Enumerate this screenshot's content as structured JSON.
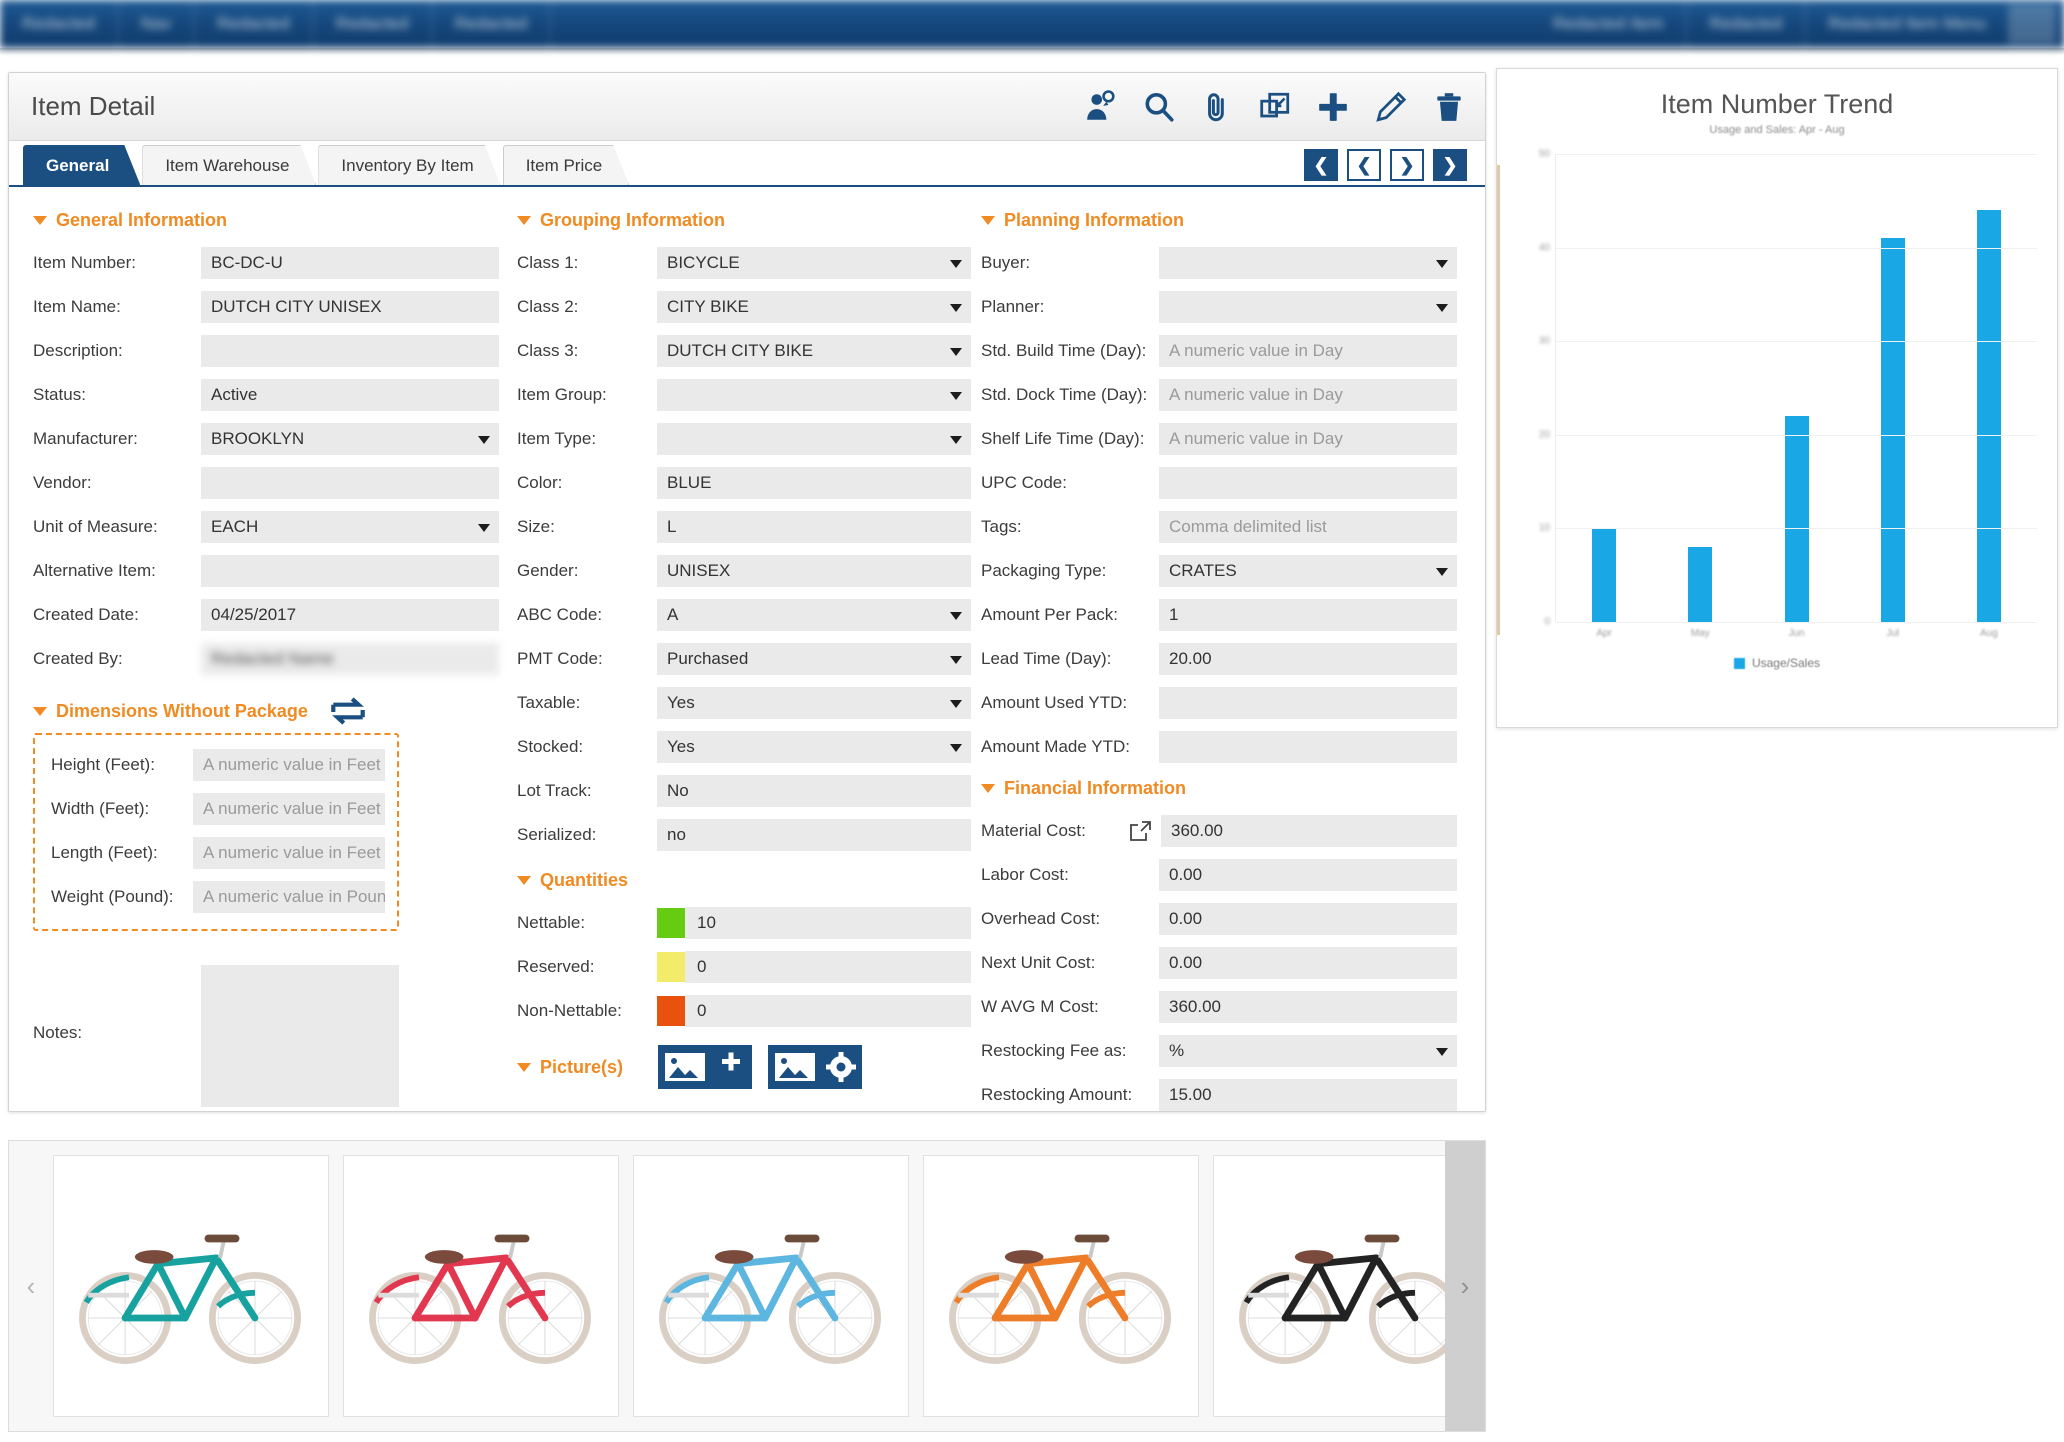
{
  "topbar": {
    "left_items": [
      "Redacted",
      "Nav",
      "Redacted",
      "Redacted",
      "Redacted"
    ],
    "right_items": [
      "Redacted Item",
      "Redacted",
      "Redacted Item Menu"
    ],
    "note": "blurred"
  },
  "panel": {
    "title": "Item Detail",
    "toolbar": [
      {
        "name": "user-lookup-icon",
        "label": "User Lookup"
      },
      {
        "name": "search-icon",
        "label": "Search"
      },
      {
        "name": "attachment-icon",
        "label": "Attachment"
      },
      {
        "name": "copy-icon",
        "label": "Copy"
      },
      {
        "name": "add-icon",
        "label": "Add"
      },
      {
        "name": "edit-icon",
        "label": "Edit"
      },
      {
        "name": "delete-icon",
        "label": "Delete"
      }
    ],
    "tabs": [
      {
        "label": "General",
        "active": true
      },
      {
        "label": "Item Warehouse",
        "active": false
      },
      {
        "label": "Inventory By Item",
        "active": false
      },
      {
        "label": "Item Price",
        "active": false
      }
    ],
    "record_nav": [
      {
        "name": "first-record-button",
        "glyph": "❮",
        "style": "filled"
      },
      {
        "name": "previous-record-button",
        "glyph": "❮",
        "style": "hollow"
      },
      {
        "name": "next-record-button",
        "glyph": "❯",
        "style": "hollow"
      },
      {
        "name": "last-record-button",
        "glyph": "❯",
        "style": "filled"
      }
    ]
  },
  "general_information": {
    "heading": "General Information",
    "fields": [
      {
        "label": "Item Number:",
        "value": "BC-DC-U",
        "placeholder": "",
        "type": "text"
      },
      {
        "label": "Item Name:",
        "value": "DUTCH CITY UNISEX",
        "placeholder": "",
        "type": "text"
      },
      {
        "label": "Description:",
        "value": "",
        "placeholder": "",
        "type": "text"
      },
      {
        "label": "Status:",
        "value": "Active",
        "placeholder": "",
        "type": "text"
      },
      {
        "label": "Manufacturer:",
        "value": "BROOKLYN",
        "placeholder": "",
        "type": "select"
      },
      {
        "label": "Vendor:",
        "value": "",
        "placeholder": "",
        "type": "text"
      },
      {
        "label": "Unit of Measure:",
        "value": "EACH",
        "placeholder": "",
        "type": "select"
      },
      {
        "label": "Alternative Item:",
        "value": "",
        "placeholder": "",
        "type": "text"
      },
      {
        "label": "Created Date:",
        "value": "04/25/2017",
        "placeholder": "",
        "type": "text"
      },
      {
        "label": "Created By:",
        "value": "Redacted Name",
        "placeholder": "",
        "type": "text",
        "blurred": true
      }
    ]
  },
  "dimensions": {
    "heading": "Dimensions Without Package",
    "swap_icon": "swap-units-icon",
    "fields": [
      {
        "label": "Height (Feet):",
        "value": "",
        "placeholder": "A numeric value in Feet",
        "type": "text"
      },
      {
        "label": "Width (Feet):",
        "value": "",
        "placeholder": "A numeric value in Feet",
        "type": "text"
      },
      {
        "label": "Length (Feet):",
        "value": "",
        "placeholder": "A numeric value in Feet",
        "type": "text"
      },
      {
        "label": "Weight (Pound):",
        "value": "",
        "placeholder": "A numeric value in Pound",
        "type": "text"
      }
    ]
  },
  "notes": {
    "label": "Notes:",
    "value": ""
  },
  "grouping_information": {
    "heading": "Grouping Information",
    "fields": [
      {
        "label": "Class 1:",
        "value": "BICYCLE",
        "placeholder": "",
        "type": "select"
      },
      {
        "label": "Class 2:",
        "value": "CITY BIKE",
        "placeholder": "",
        "type": "select"
      },
      {
        "label": "Class 3:",
        "value": "DUTCH CITY BIKE",
        "placeholder": "",
        "type": "select"
      },
      {
        "label": "Item Group:",
        "value": "",
        "placeholder": "",
        "type": "select"
      },
      {
        "label": "Item Type:",
        "value": "",
        "placeholder": "",
        "type": "select"
      },
      {
        "label": "Color:",
        "value": "BLUE",
        "placeholder": "",
        "type": "text"
      },
      {
        "label": "Size:",
        "value": "L",
        "placeholder": "",
        "type": "text"
      },
      {
        "label": "Gender:",
        "value": "UNISEX",
        "placeholder": "",
        "type": "text"
      },
      {
        "label": "ABC Code:",
        "value": "A",
        "placeholder": "",
        "type": "select"
      },
      {
        "label": "PMT Code:",
        "value": "Purchased",
        "placeholder": "",
        "type": "select"
      },
      {
        "label": "Taxable:",
        "value": "Yes",
        "placeholder": "",
        "type": "select"
      },
      {
        "label": "Stocked:",
        "value": "Yes",
        "placeholder": "",
        "type": "select"
      },
      {
        "label": "Lot Track:",
        "value": "No",
        "placeholder": "",
        "type": "text"
      },
      {
        "label": "Serialized:",
        "value": "no",
        "placeholder": "",
        "type": "text"
      }
    ]
  },
  "quantities": {
    "heading": "Quantities",
    "rows": [
      {
        "label": "Nettable:",
        "value": "10",
        "color": "#66cc11"
      },
      {
        "label": "Reserved:",
        "value": "0",
        "color": "#f2ec6a"
      },
      {
        "label": "Non-Nettable:",
        "value": "0",
        "color": "#e8520e"
      }
    ]
  },
  "pictures": {
    "heading": "Picture(s)",
    "buttons": [
      {
        "name": "add-picture-button",
        "label": "Add Picture"
      },
      {
        "name": "picture-settings-button",
        "label": "Picture Settings"
      }
    ]
  },
  "planning_information": {
    "heading": "Planning Information",
    "fields": [
      {
        "label": "Buyer:",
        "value": "",
        "placeholder": "",
        "type": "select"
      },
      {
        "label": "Planner:",
        "value": "",
        "placeholder": "",
        "type": "select"
      },
      {
        "label": "Std. Build Time (Day):",
        "value": "",
        "placeholder": "A numeric value in Day",
        "type": "text"
      },
      {
        "label": "Std. Dock Time (Day):",
        "value": "",
        "placeholder": "A numeric value in Day",
        "type": "text"
      },
      {
        "label": "Shelf Life Time (Day):",
        "value": "",
        "placeholder": "A numeric value in Day",
        "type": "text"
      },
      {
        "label": "UPC Code:",
        "value": "",
        "placeholder": "",
        "type": "text"
      },
      {
        "label": "Tags:",
        "value": "",
        "placeholder": "Comma delimited list",
        "type": "text"
      },
      {
        "label": "Packaging Type:",
        "value": "CRATES",
        "placeholder": "",
        "type": "select"
      },
      {
        "label": "Amount Per Pack:",
        "value": "1",
        "placeholder": "",
        "type": "text"
      },
      {
        "label": "Lead Time (Day):",
        "value": "20.00",
        "placeholder": "",
        "type": "text"
      },
      {
        "label": "Amount Used YTD:",
        "value": "",
        "placeholder": "",
        "type": "text"
      },
      {
        "label": "Amount Made YTD:",
        "value": "",
        "placeholder": "",
        "type": "text"
      }
    ]
  },
  "financial_information": {
    "heading": "Financial Information",
    "fields": [
      {
        "label": "Material Cost:",
        "value": "360.00",
        "placeholder": "",
        "type": "text",
        "icon": "external-link-icon"
      },
      {
        "label": "Labor Cost:",
        "value": "0.00",
        "placeholder": "",
        "type": "text"
      },
      {
        "label": "Overhead Cost:",
        "value": "0.00",
        "placeholder": "",
        "type": "text"
      },
      {
        "label": "Next Unit Cost:",
        "value": "0.00",
        "placeholder": "",
        "type": "text"
      },
      {
        "label": "W AVG M Cost:",
        "value": "360.00",
        "placeholder": "",
        "type": "text"
      },
      {
        "label": "Restocking Fee as:",
        "value": "%",
        "placeholder": "",
        "type": "select"
      },
      {
        "label": "Restocking Amount:",
        "value": "15.00",
        "placeholder": "",
        "type": "text"
      }
    ]
  },
  "chart_data": {
    "type": "bar",
    "title": "Item Number Trend",
    "subtitle": "Usage and Sales: Apr - Aug",
    "categories": [
      "Apr",
      "May",
      "Jun",
      "Jul",
      "Aug"
    ],
    "values": [
      10,
      8,
      22,
      41,
      44
    ],
    "series": [
      {
        "name": "Usage/Sales",
        "values": [
          10,
          8,
          22,
          41,
          44
        ]
      }
    ],
    "legend": [
      "Usage/Sales"
    ],
    "legend_position": "bottom",
    "xlabel": "",
    "ylabel": "",
    "ylim": [
      0,
      50
    ],
    "yticks": [
      "0",
      "10",
      "20",
      "30",
      "40",
      "50"
    ],
    "grid": true,
    "bar_color": "#19a7e6"
  },
  "gallery": {
    "prev_label": "‹",
    "next_label": "›",
    "items": [
      {
        "name": "bicycle-thumbnail-teal",
        "color": "#17a2a0"
      },
      {
        "name": "bicycle-thumbnail-red",
        "color": "#e1384f"
      },
      {
        "name": "bicycle-thumbnail-lightblue",
        "color": "#5db6e0"
      },
      {
        "name": "bicycle-thumbnail-orange",
        "color": "#ee7d2a"
      },
      {
        "name": "bicycle-thumbnail-black",
        "color": "#232323"
      }
    ]
  },
  "colors": {
    "accent_blue": "#1b4f82",
    "section_orange": "#ef8b22",
    "field_bg": "#eaeaea",
    "chart_bar": "#19a7e6"
  }
}
